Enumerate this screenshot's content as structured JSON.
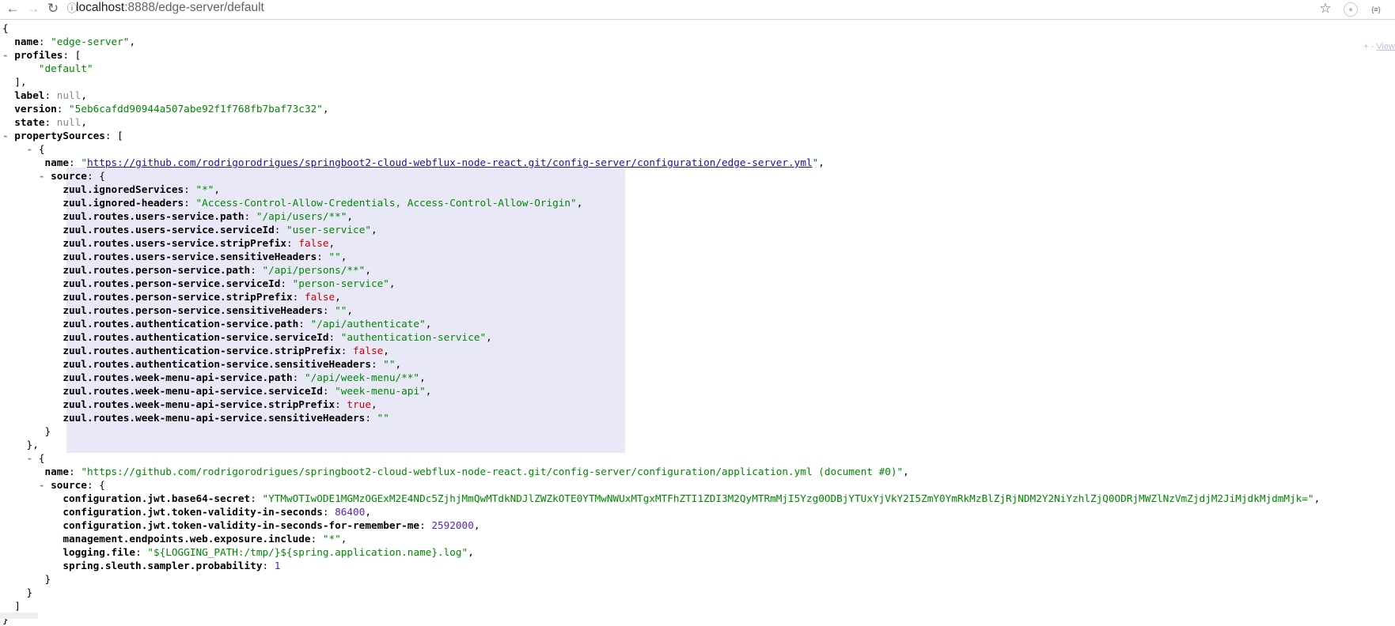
{
  "browser": {
    "url_host": "localhost",
    "url_rest": ":8888/edge-server/default"
  },
  "viewer_controls": {
    "expand": "+",
    "collapse": "-",
    "view_label": "View"
  },
  "colors": {
    "key": "#000000",
    "string": "#008800",
    "null": "#8a8a8a",
    "boolean": "#cc0000",
    "number": "#5a22c4",
    "highlight": "#e8e8f7"
  },
  "json_lines": [
    {
      "t": [
        [
          "p",
          "{"
        ]
      ]
    },
    {
      "t": [
        [
          "p",
          "  "
        ],
        [
          "k",
          "name"
        ],
        [
          "p",
          ": "
        ],
        [
          "s",
          "\"edge-server\""
        ],
        [
          "p",
          ","
        ]
      ]
    },
    {
      "c": true,
      "t": [
        [
          "k",
          "profiles"
        ],
        [
          "p",
          ": ["
        ]
      ]
    },
    {
      "t": [
        [
          "p",
          "      "
        ],
        [
          "s",
          "\"default\""
        ]
      ]
    },
    {
      "t": [
        [
          "p",
          "  ],"
        ]
      ]
    },
    {
      "t": [
        [
          "p",
          "  "
        ],
        [
          "k",
          "label"
        ],
        [
          "p",
          ": "
        ],
        [
          "n",
          "null"
        ],
        [
          "p",
          ","
        ]
      ]
    },
    {
      "t": [
        [
          "p",
          "  "
        ],
        [
          "k",
          "version"
        ],
        [
          "p",
          ": "
        ],
        [
          "s",
          "\"5eb6cafdd90944a507abe92f1f768fb7baf73c32\""
        ],
        [
          "p",
          ","
        ]
      ]
    },
    {
      "t": [
        [
          "p",
          "  "
        ],
        [
          "k",
          "state"
        ],
        [
          "p",
          ": "
        ],
        [
          "n",
          "null"
        ],
        [
          "p",
          ","
        ]
      ]
    },
    {
      "c": true,
      "t": [
        [
          "k",
          "propertySources"
        ],
        [
          "p",
          ": ["
        ]
      ]
    },
    {
      "c": true,
      "i": 4,
      "t": [
        [
          "p",
          "{"
        ]
      ]
    },
    {
      "t": [
        [
          "p",
          "       "
        ],
        [
          "k",
          "name"
        ],
        [
          "p",
          ": "
        ],
        [
          "s",
          "\""
        ],
        [
          "a",
          "https://github.com/rodrigorodrigues/springboot2-cloud-webflux-node-react.git/config-server/configuration/edge-server.yml"
        ],
        [
          "s",
          "\""
        ],
        [
          "p",
          ","
        ]
      ]
    },
    {
      "c": true,
      "i": 6,
      "t": [
        [
          "k",
          "source"
        ],
        [
          "p",
          ": {"
        ]
      ]
    },
    {
      "t": [
        [
          "p",
          "          "
        ],
        [
          "k",
          "zuul.ignoredServices"
        ],
        [
          "p",
          ": "
        ],
        [
          "s",
          "\"*\""
        ],
        [
          "p",
          ","
        ]
      ]
    },
    {
      "t": [
        [
          "p",
          "          "
        ],
        [
          "k",
          "zuul.ignored-headers"
        ],
        [
          "p",
          ": "
        ],
        [
          "s",
          "\"Access-Control-Allow-Credentials, Access-Control-Allow-Origin\""
        ],
        [
          "p",
          ","
        ]
      ]
    },
    {
      "t": [
        [
          "p",
          "          "
        ],
        [
          "k",
          "zuul.routes.users-service.path"
        ],
        [
          "p",
          ": "
        ],
        [
          "s",
          "\"/api/users/**\""
        ],
        [
          "p",
          ","
        ]
      ]
    },
    {
      "t": [
        [
          "p",
          "          "
        ],
        [
          "k",
          "zuul.routes.users-service.serviceId"
        ],
        [
          "p",
          ": "
        ],
        [
          "s",
          "\"user-service\""
        ],
        [
          "p",
          ","
        ]
      ]
    },
    {
      "t": [
        [
          "p",
          "          "
        ],
        [
          "k",
          "zuul.routes.users-service.stripPrefix"
        ],
        [
          "p",
          ": "
        ],
        [
          "b",
          "false"
        ],
        [
          "p",
          ","
        ]
      ]
    },
    {
      "t": [
        [
          "p",
          "          "
        ],
        [
          "k",
          "zuul.routes.users-service.sensitiveHeaders"
        ],
        [
          "p",
          ": "
        ],
        [
          "s",
          "\"\""
        ],
        [
          "p",
          ","
        ]
      ]
    },
    {
      "t": [
        [
          "p",
          "          "
        ],
        [
          "k",
          "zuul.routes.person-service.path"
        ],
        [
          "p",
          ": "
        ],
        [
          "s",
          "\"/api/persons/**\""
        ],
        [
          "p",
          ","
        ]
      ]
    },
    {
      "t": [
        [
          "p",
          "          "
        ],
        [
          "k",
          "zuul.routes.person-service.serviceId"
        ],
        [
          "p",
          ": "
        ],
        [
          "s",
          "\"person-service\""
        ],
        [
          "p",
          ","
        ]
      ]
    },
    {
      "t": [
        [
          "p",
          "          "
        ],
        [
          "k",
          "zuul.routes.person-service.stripPrefix"
        ],
        [
          "p",
          ": "
        ],
        [
          "b",
          "false"
        ],
        [
          "p",
          ","
        ]
      ]
    },
    {
      "t": [
        [
          "p",
          "          "
        ],
        [
          "k",
          "zuul.routes.person-service.sensitiveHeaders"
        ],
        [
          "p",
          ": "
        ],
        [
          "s",
          "\"\""
        ],
        [
          "p",
          ","
        ]
      ]
    },
    {
      "t": [
        [
          "p",
          "          "
        ],
        [
          "k",
          "zuul.routes.authentication-service.path"
        ],
        [
          "p",
          ": "
        ],
        [
          "s",
          "\"/api/authenticate\""
        ],
        [
          "p",
          ","
        ]
      ]
    },
    {
      "t": [
        [
          "p",
          "          "
        ],
        [
          "k",
          "zuul.routes.authentication-service.serviceId"
        ],
        [
          "p",
          ": "
        ],
        [
          "s",
          "\"authentication-service\""
        ],
        [
          "p",
          ","
        ]
      ]
    },
    {
      "t": [
        [
          "p",
          "          "
        ],
        [
          "k",
          "zuul.routes.authentication-service.stripPrefix"
        ],
        [
          "p",
          ": "
        ],
        [
          "b",
          "false"
        ],
        [
          "p",
          ","
        ]
      ]
    },
    {
      "t": [
        [
          "p",
          "          "
        ],
        [
          "k",
          "zuul.routes.authentication-service.sensitiveHeaders"
        ],
        [
          "p",
          ": "
        ],
        [
          "s",
          "\"\""
        ],
        [
          "p",
          ","
        ]
      ]
    },
    {
      "t": [
        [
          "p",
          "          "
        ],
        [
          "k",
          "zuul.routes.week-menu-api-service.path"
        ],
        [
          "p",
          ": "
        ],
        [
          "s",
          "\"/api/week-menu/**\""
        ],
        [
          "p",
          ","
        ]
      ]
    },
    {
      "t": [
        [
          "p",
          "          "
        ],
        [
          "k",
          "zuul.routes.week-menu-api-service.serviceId"
        ],
        [
          "p",
          ": "
        ],
        [
          "s",
          "\"week-menu-api\""
        ],
        [
          "p",
          ","
        ]
      ]
    },
    {
      "t": [
        [
          "p",
          "          "
        ],
        [
          "k",
          "zuul.routes.week-menu-api-service.stripPrefix"
        ],
        [
          "p",
          ": "
        ],
        [
          "b",
          "true"
        ],
        [
          "p",
          ","
        ]
      ]
    },
    {
      "t": [
        [
          "p",
          "          "
        ],
        [
          "k",
          "zuul.routes.week-menu-api-service.sensitiveHeaders"
        ],
        [
          "p",
          ": "
        ],
        [
          "s",
          "\"\""
        ]
      ]
    },
    {
      "t": [
        [
          "p",
          "       }"
        ]
      ]
    },
    {
      "t": [
        [
          "p",
          "    },"
        ]
      ]
    },
    {
      "c": true,
      "i": 4,
      "t": [
        [
          "p",
          "{"
        ]
      ]
    },
    {
      "t": [
        [
          "p",
          "       "
        ],
        [
          "k",
          "name"
        ],
        [
          "p",
          ": "
        ],
        [
          "s",
          "\"https://github.com/rodrigorodrigues/springboot2-cloud-webflux-node-react.git/config-server/configuration/application.yml (document #0)\""
        ],
        [
          "p",
          ","
        ]
      ]
    },
    {
      "c": true,
      "i": 6,
      "t": [
        [
          "k",
          "source"
        ],
        [
          "p",
          ": {"
        ]
      ]
    },
    {
      "t": [
        [
          "p",
          "          "
        ],
        [
          "k",
          "configuration.jwt.base64-secret"
        ],
        [
          "p",
          ": "
        ],
        [
          "s",
          "\"YTMwOTIwODE1MGMzOGExM2E4NDc5ZjhjMmQwMTdkNDJlZWZkOTE0YTMwNWUxMTgxMTFhZTI1ZDI3M2QyMTRmMjI5Yzg0ODBjYTUxYjVkY2I5ZmY0YmRkMzBlZjRjNDM2Y2NiYzhlZjQ0ODRjMWZlNzVmZjdjM2JiMjdkMjdmMjk=\""
        ],
        [
          "p",
          ","
        ]
      ]
    },
    {
      "t": [
        [
          "p",
          "          "
        ],
        [
          "k",
          "configuration.jwt.token-validity-in-seconds"
        ],
        [
          "p",
          ": "
        ],
        [
          "num",
          "86400"
        ],
        [
          "p",
          ","
        ]
      ]
    },
    {
      "t": [
        [
          "p",
          "          "
        ],
        [
          "k",
          "configuration.jwt.token-validity-in-seconds-for-remember-me"
        ],
        [
          "p",
          ": "
        ],
        [
          "num",
          "2592000"
        ],
        [
          "p",
          ","
        ]
      ]
    },
    {
      "t": [
        [
          "p",
          "          "
        ],
        [
          "k",
          "management.endpoints.web.exposure.include"
        ],
        [
          "p",
          ": "
        ],
        [
          "s",
          "\"*\""
        ],
        [
          "p",
          ","
        ]
      ]
    },
    {
      "t": [
        [
          "p",
          "          "
        ],
        [
          "k",
          "logging.file"
        ],
        [
          "p",
          ": "
        ],
        [
          "s",
          "\"${LOGGING_PATH:/tmp/}${spring.application.name}.log\""
        ],
        [
          "p",
          ","
        ]
      ]
    },
    {
      "t": [
        [
          "p",
          "          "
        ],
        [
          "k",
          "spring.sleuth.sampler.probability"
        ],
        [
          "p",
          ": "
        ],
        [
          "num",
          "1"
        ]
      ]
    },
    {
      "t": [
        [
          "p",
          "       }"
        ]
      ]
    },
    {
      "t": [
        [
          "p",
          "    }"
        ]
      ]
    },
    {
      "t": [
        [
          "p",
          "  ]"
        ]
      ]
    },
    {
      "t": [
        [
          "p",
          "}"
        ]
      ]
    }
  ]
}
